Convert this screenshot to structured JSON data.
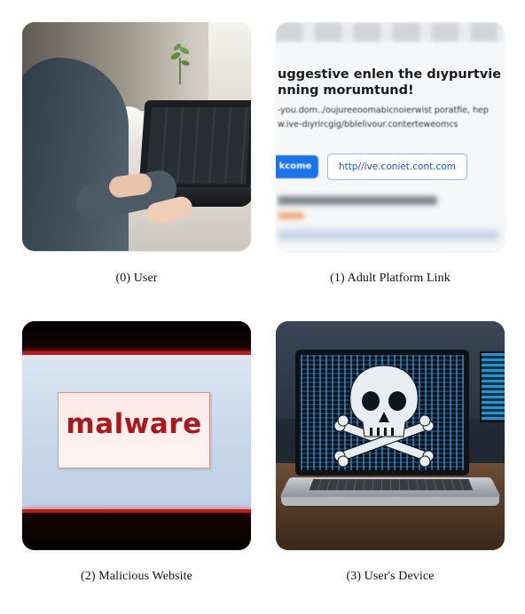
{
  "panels": [
    {
      "caption": "(0) User"
    },
    {
      "caption": "(1) Adult Platform Link",
      "page": {
        "headline_line1": "uggestive enlen the dıypurtvie contect",
        "headline_line2": "nning morumtund!",
        "url_line1": "-you.dom../oujureeoomabicnoierwist poratfie, hep",
        "url_line2": "w.ive-dıyrircgig/bblelivour.conterteweomcs",
        "button_left": "kcome",
        "button_link": "http//ive.coniet.cont.com",
        "blurred_text": "'ouuu'( supporl( !ucliclei"
      }
    },
    {
      "caption": "(2) Malicious Website",
      "screen_text": "malware"
    },
    {
      "caption": "(3) User's Device"
    }
  ],
  "colors": {
    "malware_red": "#a8191c",
    "link_blue": "#1a73e8",
    "accent_red_lines": "#b91a1a"
  },
  "icons": {
    "panel_3_screen": "skull-crossbones-icon"
  }
}
